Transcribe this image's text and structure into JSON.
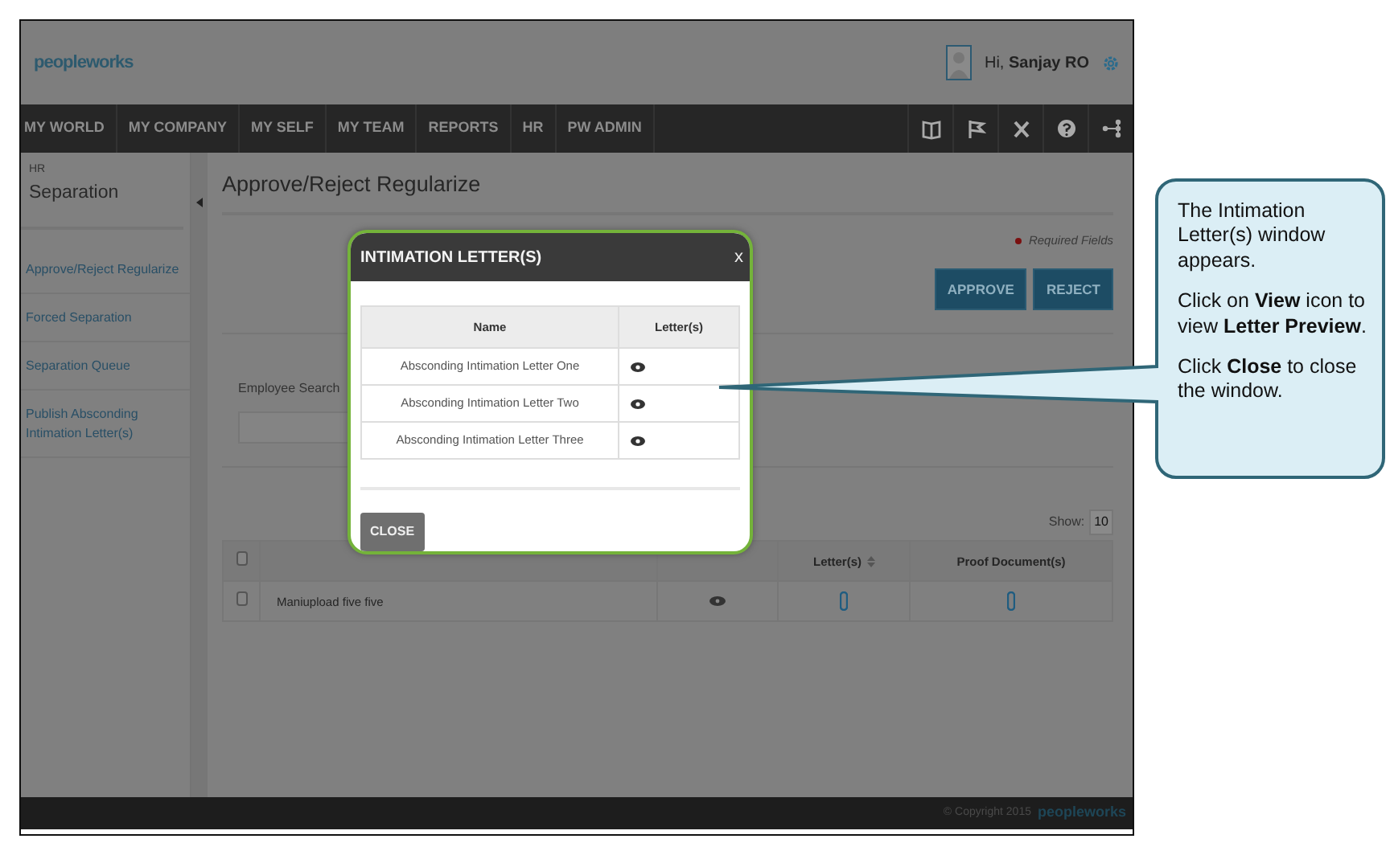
{
  "header": {
    "logo": "peopleworks",
    "greeting": "Hi, **Sanjay RO**"
  },
  "nav": {
    "items": [
      "MY WORLD",
      "MY COMPANY",
      "MY SELF",
      "MY TEAM",
      "REPORTS",
      "HR",
      "PW ADMIN"
    ]
  },
  "sidebar": {
    "section": "HR",
    "title": "Separation",
    "items": [
      {
        "label": "Approve/Reject Regularize"
      },
      {
        "label": "Forced Separation"
      },
      {
        "label": "Separation Queue"
      },
      {
        "label": "Publish Absconding Intimation Letter(s)"
      }
    ]
  },
  "page": {
    "title": "Approve/Reject Regularize",
    "required_note": "Required Fields",
    "buttons": [
      "APPROVE",
      "REJECT"
    ],
    "search_label": "Employee Search",
    "show_label": "Show:",
    "show_value": "10",
    "table": {
      "select_all_checked": false,
      "columns": [
        "",
        "",
        "",
        "Letter(s)",
        "Proof Document(s)"
      ],
      "rows": [
        {
          "checked": false,
          "name": "Maniupload five five"
        }
      ]
    }
  },
  "modal": {
    "title": "INTIMATION LETTER(S)",
    "close_mark": "x",
    "columns": [
      "Name",
      "Letter(s)"
    ],
    "rows": [
      {
        "name": "Absconding Intimation Letter One"
      },
      {
        "name": "Absconding Intimation Letter Two"
      },
      {
        "name": "Absconding Intimation Letter Three"
      }
    ],
    "button": "CLOSE"
  },
  "footer": {
    "copyright": "© Copyright 2015",
    "logo": "peopleworks"
  },
  "callout": {
    "paragraphs": [
      "The Intimation Letter(s) window appears.",
      "Click on **View** icon to view **Letter Preview**.",
      "Click **Close** to close the window."
    ]
  }
}
